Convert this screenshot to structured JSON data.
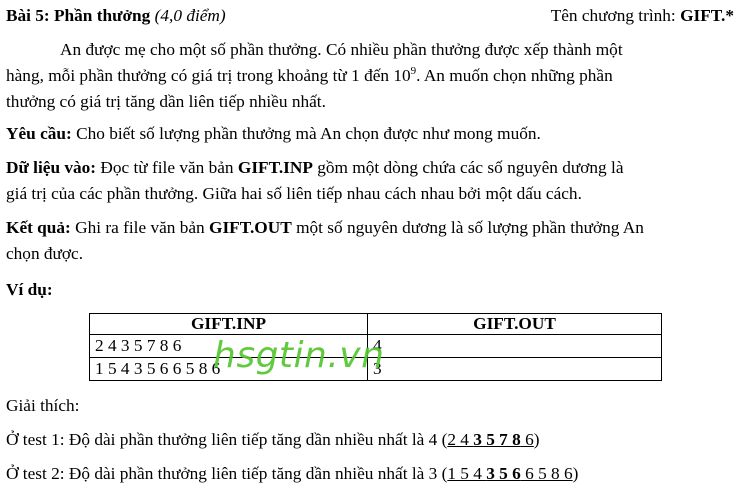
{
  "header": {
    "problem_label": "Bài 5: Phần thưởng",
    "points": "(4,0 điểm)",
    "program_prefix": "Tên chương trình: ",
    "program_name": "GIFT.*"
  },
  "intro": {
    "line1": "An được mẹ cho một số phần thưởng. Có nhiều phần thưởng được xếp thành một",
    "line2_a": "hàng, mỗi phần thưởng có giá trị trong khoảng từ 1 đến 10",
    "line2_sup": "9",
    "line2_b": ". An muốn chọn những phần",
    "line3": "thưởng có giá trị tăng dần liên tiếp nhiều nhất."
  },
  "requirement": {
    "label": "Yêu cầu:",
    "text": " Cho biết số lượng phần thưởng mà An chọn được như mong muốn."
  },
  "input": {
    "label": "Dữ liệu vào:",
    "text_a": " Đọc từ file văn bản ",
    "file": "GIFT.INP",
    "text_b": " gồm một dòng chứa các số nguyên dương là",
    "line2": "giá trị của các phần thưởng. Giữa hai số liên tiếp nhau cách nhau bởi một dấu cách."
  },
  "output": {
    "label": "Kết quả:",
    "text_a": " Ghi ra file văn bản ",
    "file": "GIFT.OUT",
    "text_b": " một số nguyên dương là số lượng phần thưởng An",
    "line2": "chọn được."
  },
  "example": {
    "label": "Ví dụ:",
    "headers": [
      "GIFT.INP",
      "GIFT.OUT"
    ],
    "rows": [
      [
        "2 4 3 5 7 8 6",
        "4"
      ],
      [
        "1 5 4 3 5 6 6 5 8 6",
        "3"
      ]
    ]
  },
  "watermark": "hsgtin.vn",
  "explanation": {
    "label": "Giải thích:",
    "test1_prefix": "Ở test 1: Độ dài phần thưởng liên tiếp tăng dần nhiều nhất là 4 (",
    "test1_plain": "2 4 ",
    "test1_bold": "3 5 7 8",
    "test1_tail": " 6",
    "test1_suffix": ")",
    "test2_prefix": "Ở test 2: Độ dài phần thưởng liên tiếp tăng dần nhiều nhất là 3 (",
    "test2_plain": "1 5 4 ",
    "test2_bold": "3 5 6",
    "test2_tail": " 6 5 8 6",
    "test2_suffix": ")"
  }
}
